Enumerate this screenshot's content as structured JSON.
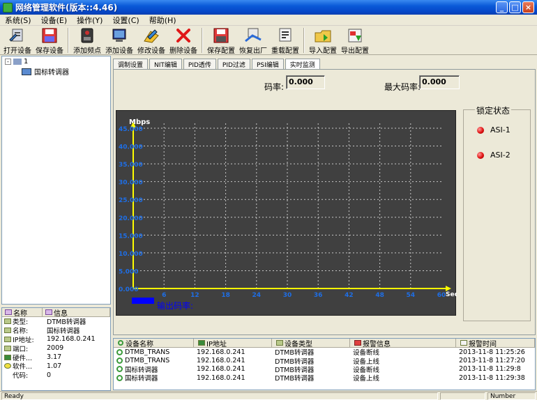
{
  "window": {
    "title": "网络管理软件(版本::4.46)",
    "min": "_",
    "max": "□",
    "close": "×"
  },
  "menu": [
    "系统(S)",
    "设备(E)",
    "操作(Y)",
    "设置(C)",
    "帮助(H)"
  ],
  "toolbar": [
    {
      "label": "打开设备",
      "icon": "open-device-icon"
    },
    {
      "label": "保存设备",
      "icon": "save-device-icon"
    },
    {
      "label": "添加频点",
      "icon": "add-frequency-icon"
    },
    {
      "label": "添加设备",
      "icon": "add-device-icon"
    },
    {
      "label": "修改设备",
      "icon": "edit-device-icon"
    },
    {
      "label": "删除设备",
      "icon": "delete-device-icon"
    },
    {
      "label": "保存配置",
      "icon": "save-config-icon"
    },
    {
      "label": "恢复出厂",
      "icon": "factory-reset-icon"
    },
    {
      "label": "重载配置",
      "icon": "reload-config-icon"
    },
    {
      "label": "导入配置",
      "icon": "import-config-icon"
    },
    {
      "label": "导出配置",
      "icon": "export-config-icon"
    }
  ],
  "tree": {
    "root": "1",
    "child": "国标转调器"
  },
  "info": {
    "headers": [
      "名称",
      "信息"
    ],
    "rows": [
      {
        "k": "类型:",
        "v": "DTMB转调器"
      },
      {
        "k": "名称:",
        "v": "国标转调器"
      },
      {
        "k": "IP地址:",
        "v": "192.168.0.241"
      },
      {
        "k": "端口:",
        "v": "2009"
      },
      {
        "k": "硬件...",
        "v": "3.17"
      },
      {
        "k": "软件...",
        "v": "1.07"
      },
      {
        "k": "代码:",
        "v": "0"
      }
    ]
  },
  "tabs": [
    "调制设置",
    "NIT编辑",
    "PID透传",
    "PID过滤",
    "PSI编辑",
    "实时监测"
  ],
  "active_tab": 5,
  "monitor": {
    "rate_label": "码率:",
    "rate_value": "0.000",
    "max_rate_label": "最大码率:",
    "max_rate_value": "0.000",
    "lock_title": "锁定状态",
    "lock_items": [
      "ASI-1",
      "ASI-2"
    ],
    "series_label": "输出码率:",
    "colors": {
      "plot_bg": "#404040",
      "axis": "#ffff00",
      "ticks": "#1e6ee6",
      "grid": "#c8c8c8",
      "series": "#0000ff",
      "led": "#e01010"
    }
  },
  "chart_data": {
    "type": "line",
    "ylabel": "Mbps",
    "xlabel": "Sec.",
    "ylim": [
      0,
      45
    ],
    "xlim": [
      0,
      60
    ],
    "y_ticks": [
      "0.000",
      "5.000",
      "10.000",
      "15.000",
      "20.000",
      "25.000",
      "30.000",
      "35.000",
      "40.000",
      "45.000"
    ],
    "x_ticks": [
      "6",
      "12",
      "18",
      "24",
      "30",
      "36",
      "42",
      "48",
      "54",
      "60"
    ],
    "grid": true,
    "series": [
      {
        "name": "输出码率:",
        "values": []
      }
    ]
  },
  "events": {
    "headers": [
      "设备名称",
      "IP地址",
      "设备类型",
      "报警信息",
      "报警时间"
    ],
    "rows": [
      [
        "DTMB_TRANS",
        "192.168.0.241",
        "DTMB转调器",
        "设备断线",
        "2013-11-8 11:25:26"
      ],
      [
        "DTMB_TRANS",
        "192.168.0.241",
        "DTMB转调器",
        "设备上线",
        "2013-11-8 11:27:20"
      ],
      [
        "国标转调器",
        "192.168.0.241",
        "DTMB转调器",
        "设备断线",
        "2013-11-8 11:29:8"
      ],
      [
        "国标转调器",
        "192.168.0.241",
        "DTMB转调器",
        "设备上线",
        "2013-11-8 11:29:38"
      ]
    ]
  },
  "status": {
    "left": "Ready",
    "right": "Number"
  }
}
